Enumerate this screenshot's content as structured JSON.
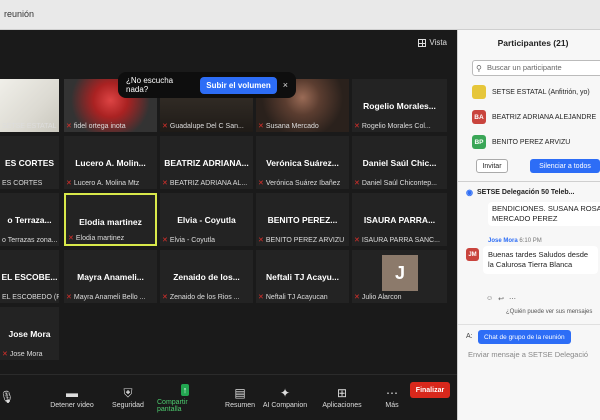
{
  "window": {
    "title": "reunión"
  },
  "meeting": {
    "view_label": "Vista",
    "toast": {
      "text": "¿No escucha nada?",
      "button": "Subir el volumen",
      "close": "×"
    },
    "tiles": [
      {
        "name": "",
        "caption": "SETSE ESTATAL",
        "muted": false,
        "photo": "logo"
      },
      {
        "name": "",
        "caption": "fidel ortega inota",
        "muted": true,
        "photo": "person-red"
      },
      {
        "name": "",
        "caption": "Guadalupe Del C San...",
        "muted": true,
        "photo": "person-dark"
      },
      {
        "name": "",
        "caption": "Susana Mercado",
        "muted": true,
        "photo": "person-woman"
      },
      {
        "name": "Rogelio Morales...",
        "caption": "Rogelio Morales Col...",
        "muted": true
      },
      {
        "name": "ES CORTES",
        "caption": "ES CORTES",
        "muted": false
      },
      {
        "name": "Lucero A. Molin...",
        "caption": "Lucero A. Molina Mtz",
        "muted": true
      },
      {
        "name": "BEATRIZ ADRIANA...",
        "caption": "BEATRIZ ADRIANA AL...",
        "muted": true
      },
      {
        "name": "Verónica Suárez...",
        "caption": "Verónica Suárez Ibañez",
        "muted": true
      },
      {
        "name": "Daniel Saúl Chic...",
        "caption": "Daniel Saúl Chicontep...",
        "muted": true
      },
      {
        "name": "o Terraza...",
        "caption": "o Terrazas zona...",
        "muted": false
      },
      {
        "name": "Elodia martinez",
        "caption": "Elodia martinez",
        "muted": true,
        "active": true
      },
      {
        "name": "Elvia - Coyutla",
        "caption": "Elvia - Coyutla",
        "muted": true
      },
      {
        "name": "BENITO PEREZ...",
        "caption": "BENITO PEREZ ARVIZU",
        "muted": true
      },
      {
        "name": "ISAURA PARRA...",
        "caption": "ISAURA PARRA SANC...",
        "muted": true
      },
      {
        "name": "EL ESCOBE...",
        "caption": "EL ESCOBEDO (P...",
        "muted": false
      },
      {
        "name": "Mayra Anameli...",
        "caption": "Mayra Anameli Bello ...",
        "muted": true
      },
      {
        "name": "Zenaido de los...",
        "caption": "Zenaido de los Rios ...",
        "muted": true
      },
      {
        "name": "Neftali TJ Acayu...",
        "caption": "Neftali TJ Acayucan",
        "muted": true
      },
      {
        "name": "",
        "caption": "Julio Alarcon",
        "muted": true,
        "photo": "initial",
        "initial": "J"
      },
      {
        "name": "Jose Mora",
        "caption": "Jose Mora",
        "muted": true
      }
    ]
  },
  "toolbar": {
    "items": [
      {
        "label": "",
        "icon": "mic-icon"
      },
      {
        "label": "Detener video",
        "icon": "video-icon"
      },
      {
        "label": "Seguridad",
        "icon": "shield-icon"
      },
      {
        "label": "Compartir pantalla",
        "icon": "share-icon",
        "accent": true
      },
      {
        "label": "Resumen",
        "icon": "summary-icon"
      },
      {
        "label": "AI Companion",
        "icon": "sparkle-icon"
      },
      {
        "label": "Aplicaciones",
        "icon": "apps-icon"
      },
      {
        "label": "Más",
        "icon": "more-icon"
      }
    ],
    "finish": "Finalizar"
  },
  "participants": {
    "title": "Participantes (21)",
    "search_placeholder": "Buscar un participante",
    "list": [
      {
        "avatar_text": "",
        "color": "#e6c63a",
        "name": "SETSE ESTATAL (Anfitrión, yo)"
      },
      {
        "avatar_text": "BA",
        "color": "#c9443d",
        "name": "BEATRIZ ADRIANA ALEJANDRE"
      },
      {
        "avatar_text": "BP",
        "color": "#3aa657",
        "name": "BENITO PEREZ ARVIZU"
      }
    ],
    "invite": "Invitar",
    "mute_all": "Silenciar a todos"
  },
  "chat": {
    "header": "SETSE Delegación 50 Teleb...",
    "prev_message": "BENDICIONES. SUSANA ROSARIO MERCADO PEREZ",
    "sender": "Jose Mora",
    "time": "6:10 PM",
    "avatar": "JM",
    "message": "Buenas tardes Saludos desde la Calurosa Tierra Blanca",
    "who_can_see": "¿Quién puede ver sus mensajes",
    "to_label": "A:",
    "to_target": "Chat de grupo de la reunión",
    "input_placeholder": "Enviar mensaje a SETSE Delegació"
  },
  "colors": {
    "accent": "#2d6df6",
    "finish": "#d8281c",
    "active_border": "#d8e84a"
  }
}
